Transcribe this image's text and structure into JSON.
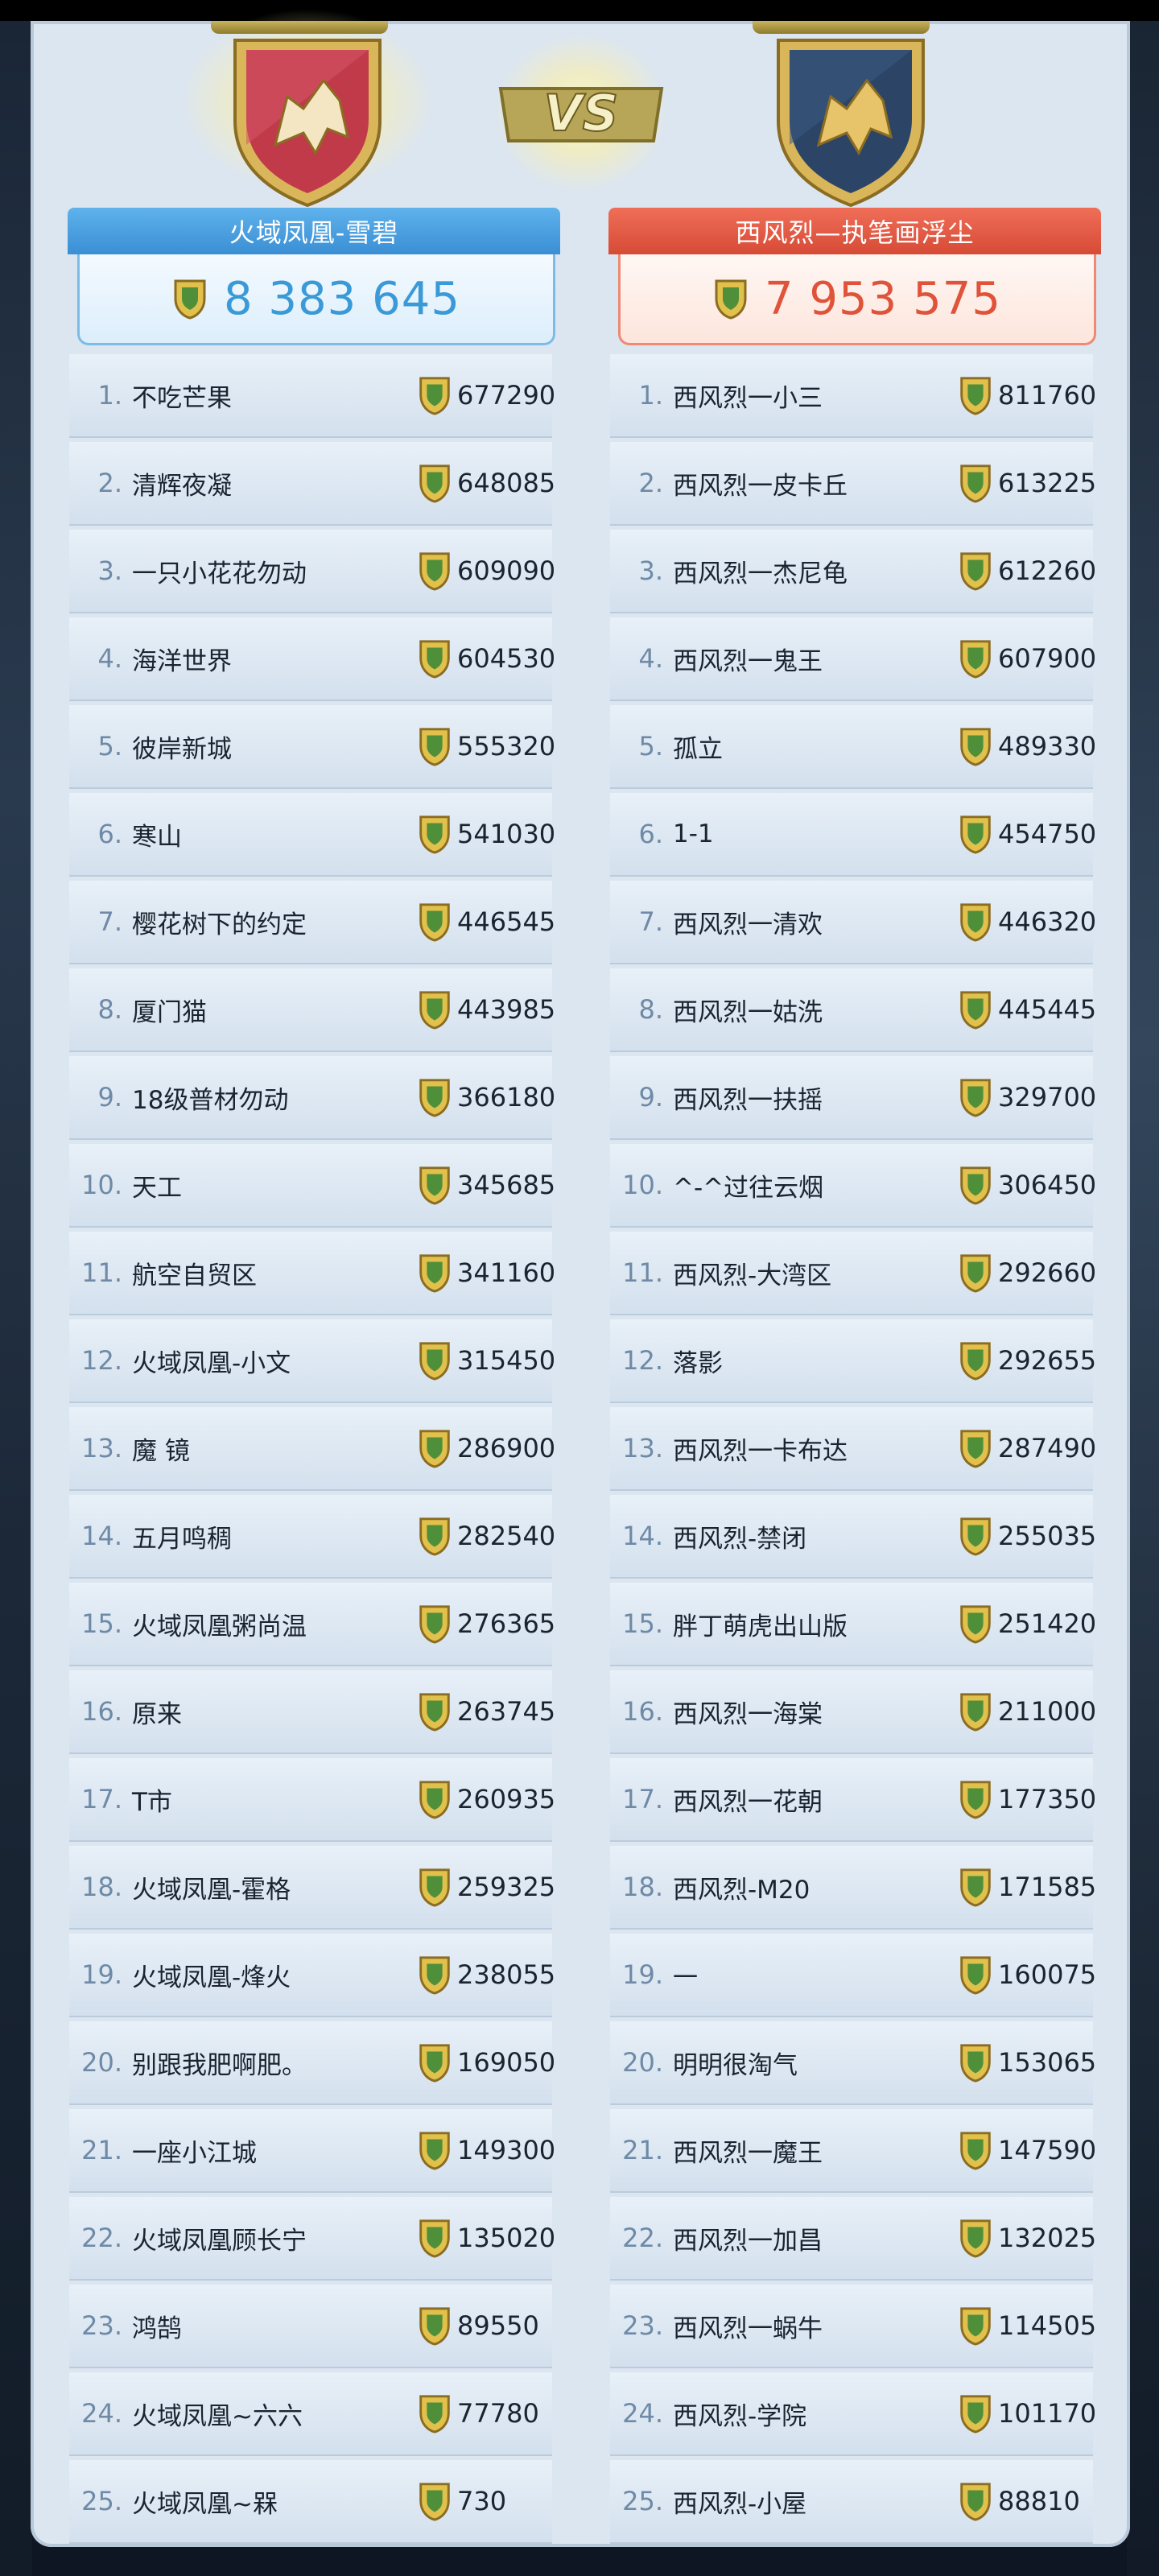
{
  "colors": {
    "left_accent": "#3a9ad8",
    "right_accent": "#e0533a",
    "panel": "#dce6f1"
  },
  "vs_label": "VS",
  "left_team": {
    "name": "火域凤凰-雪碧",
    "total": "8 383 645",
    "icon": "wolf-shield-icon",
    "players": [
      {
        "rank": "1.",
        "name": "不吃芒果",
        "score": "677290"
      },
      {
        "rank": "2.",
        "name": "清辉夜凝",
        "score": "648085"
      },
      {
        "rank": "3.",
        "name": "一只小花花勿动",
        "score": "609090"
      },
      {
        "rank": "4.",
        "name": "海洋世界",
        "score": "604530"
      },
      {
        "rank": "5.",
        "name": "彼岸新城",
        "score": "555320"
      },
      {
        "rank": "6.",
        "name": "寒山",
        "score": "541030"
      },
      {
        "rank": "7.",
        "name": "樱花树下的约定",
        "score": "446545"
      },
      {
        "rank": "8.",
        "name": "厦门猫",
        "score": "443985"
      },
      {
        "rank": "9.",
        "name": "18级普材勿动",
        "score": "366180"
      },
      {
        "rank": "10.",
        "name": "天工",
        "score": "345685"
      },
      {
        "rank": "11.",
        "name": "航空自贸区",
        "score": "341160"
      },
      {
        "rank": "12.",
        "name": "火域凤凰-小文",
        "score": "315450"
      },
      {
        "rank": "13.",
        "name": "魔 镜",
        "score": "286900"
      },
      {
        "rank": "14.",
        "name": "五月鸣稠",
        "score": "282540"
      },
      {
        "rank": "15.",
        "name": "火域凤凰粥尚温",
        "score": "276365"
      },
      {
        "rank": "16.",
        "name": "原来",
        "score": "263745"
      },
      {
        "rank": "17.",
        "name": "T市",
        "score": "260935"
      },
      {
        "rank": "18.",
        "name": "火域凤凰-霍格",
        "score": "259325"
      },
      {
        "rank": "19.",
        "name": "火域凤凰-烽火",
        "score": "238055"
      },
      {
        "rank": "20.",
        "name": "别跟我肥啊肥。",
        "score": "169050"
      },
      {
        "rank": "21.",
        "name": "一座小江城",
        "score": "149300"
      },
      {
        "rank": "22.",
        "name": "火域凤凰顾长宁",
        "score": "135020"
      },
      {
        "rank": "23.",
        "name": "鸿鹄",
        "score": "89550"
      },
      {
        "rank": "24.",
        "name": "火域凤凰~六六",
        "score": "77780"
      },
      {
        "rank": "25.",
        "name": "火域凤凰~槑",
        "score": "730"
      }
    ]
  },
  "right_team": {
    "name": "西风烈—执笔画浮尘",
    "total": "7 953 575",
    "icon": "wolf-shield-icon",
    "players": [
      {
        "rank": "1.",
        "name": "西风烈一小三",
        "score": "811760"
      },
      {
        "rank": "2.",
        "name": "西风烈一皮卡丘",
        "score": "613225"
      },
      {
        "rank": "3.",
        "name": "西风烈一杰尼龟",
        "score": "612260"
      },
      {
        "rank": "4.",
        "name": "西风烈一鬼王",
        "score": "607900"
      },
      {
        "rank": "5.",
        "name": "孤立",
        "score": "489330"
      },
      {
        "rank": "6.",
        "name": "1-1",
        "score": "454750"
      },
      {
        "rank": "7.",
        "name": "西风烈一清欢",
        "score": "446320"
      },
      {
        "rank": "8.",
        "name": "西风烈一姑洗",
        "score": "445445"
      },
      {
        "rank": "9.",
        "name": "西风烈一扶摇",
        "score": "329700"
      },
      {
        "rank": "10.",
        "name": "^-^过往云烟",
        "score": "306450"
      },
      {
        "rank": "11.",
        "name": "西风烈-大湾区",
        "score": "292660"
      },
      {
        "rank": "12.",
        "name": "落影",
        "score": "292655"
      },
      {
        "rank": "13.",
        "name": "西风烈一卡布达",
        "score": "287490"
      },
      {
        "rank": "14.",
        "name": "西风烈-禁闭",
        "score": "255035"
      },
      {
        "rank": "15.",
        "name": "胖丁萌虎出山版",
        "score": "251420"
      },
      {
        "rank": "16.",
        "name": "西风烈一海棠",
        "score": "211000"
      },
      {
        "rank": "17.",
        "name": "西风烈一花朝",
        "score": "177350"
      },
      {
        "rank": "18.",
        "name": "西风烈-M20",
        "score": "171585"
      },
      {
        "rank": "19.",
        "name": "一",
        "score": "160075"
      },
      {
        "rank": "20.",
        "name": "明明很淘气",
        "score": "153065"
      },
      {
        "rank": "21.",
        "name": "西风烈一魔王",
        "score": "147590"
      },
      {
        "rank": "22.",
        "name": "西风烈一加昌",
        "score": "132025"
      },
      {
        "rank": "23.",
        "name": "西风烈一蜗牛",
        "score": "114505"
      },
      {
        "rank": "24.",
        "name": "西风烈-学院",
        "score": "101170"
      },
      {
        "rank": "25.",
        "name": "西风烈-小屋",
        "score": "88810"
      }
    ]
  }
}
